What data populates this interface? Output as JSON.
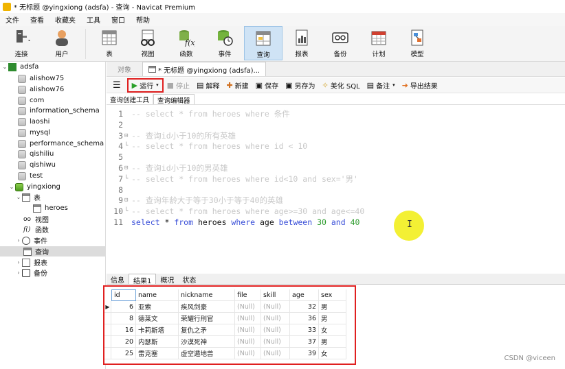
{
  "window": {
    "title": "* 无标题 @yingxiong (adsfa) - 查询 - Navicat Premium"
  },
  "menu": [
    "文件",
    "查看",
    "收藏夹",
    "工具",
    "窗口",
    "帮助"
  ],
  "ribbon": [
    {
      "label": "连接",
      "icon": "connection-icon"
    },
    {
      "label": "用户",
      "icon": "user-icon"
    },
    {
      "label": "表",
      "icon": "table-icon"
    },
    {
      "label": "视图",
      "icon": "view-icon"
    },
    {
      "label": "函数",
      "icon": "function-icon"
    },
    {
      "label": "事件",
      "icon": "event-icon"
    },
    {
      "label": "查询",
      "icon": "query-icon"
    },
    {
      "label": "报表",
      "icon": "report-icon"
    },
    {
      "label": "备份",
      "icon": "backup-icon"
    },
    {
      "label": "计划",
      "icon": "schedule-icon"
    },
    {
      "label": "模型",
      "icon": "model-icon"
    }
  ],
  "sidebar": {
    "connection": "adsfa",
    "databases": [
      "alishow75",
      "alishow76",
      "com",
      "information_schema",
      "laoshi",
      "mysql",
      "performance_schema",
      "qishiliu",
      "qishiwu",
      "test"
    ],
    "open_db": "yingxiong",
    "children": {
      "tables_label": "表",
      "table_item": "heroes",
      "views_label": "视图",
      "functions_label": "函数",
      "events_label": "事件",
      "queries_label": "查询",
      "reports_label": "报表",
      "backups_label": "备份"
    }
  },
  "tabs": {
    "objects": "对象",
    "query": "* 无标题 @yingxiong (adsfa)..."
  },
  "toolbar": {
    "run": "运行",
    "stop": "停止",
    "explain": "解释",
    "new": "新建",
    "save": "保存",
    "save_as": "另存为",
    "beautify": "美化 SQL",
    "comment": "备注",
    "export": "导出结果"
  },
  "subtabs": [
    "查询创建工具",
    "查询编辑器"
  ],
  "editor": {
    "lines": [
      {
        "n": "1",
        "fold": "",
        "parts": [
          {
            "t": "-- select * from heroes where 条件",
            "c": "cmt"
          }
        ]
      },
      {
        "n": "2",
        "fold": "",
        "parts": []
      },
      {
        "n": "3",
        "fold": "⊟",
        "parts": [
          {
            "t": "-- 查询id小于10的所有英雄",
            "c": "cmt"
          }
        ]
      },
      {
        "n": "4",
        "fold": "└",
        "parts": [
          {
            "t": "-- select * from heroes where id < 10",
            "c": "cmt"
          }
        ]
      },
      {
        "n": "5",
        "fold": "",
        "parts": []
      },
      {
        "n": "6",
        "fold": "⊟",
        "parts": [
          {
            "t": "-- 查询id小于10的男英雄",
            "c": "cmt"
          }
        ]
      },
      {
        "n": "7",
        "fold": "└",
        "parts": [
          {
            "t": "-- select * from heroes where id<10 and sex='男'",
            "c": "cmt"
          }
        ]
      },
      {
        "n": "8",
        "fold": "",
        "parts": []
      },
      {
        "n": "9",
        "fold": "⊟",
        "parts": [
          {
            "t": "-- 查询年龄大于等于30小于等于40的英雄",
            "c": "cmt"
          }
        ]
      },
      {
        "n": "10",
        "fold": "└",
        "parts": [
          {
            "t": "-- select * from heroes where age>=30 and age<=40",
            "c": "cmt"
          }
        ]
      },
      {
        "n": "11",
        "fold": "",
        "parts": [
          {
            "t": "select",
            "c": "kw"
          },
          {
            "t": " * ",
            "c": "plain"
          },
          {
            "t": "from",
            "c": "kw"
          },
          {
            "t": " heroes ",
            "c": "plain"
          },
          {
            "t": "where",
            "c": "kw"
          },
          {
            "t": " age ",
            "c": "plain"
          },
          {
            "t": "between",
            "c": "kw"
          },
          {
            "t": " ",
            "c": "plain"
          },
          {
            "t": "30",
            "c": "num"
          },
          {
            "t": " ",
            "c": "plain"
          },
          {
            "t": "and",
            "c": "kw"
          },
          {
            "t": " ",
            "c": "plain"
          },
          {
            "t": "40",
            "c": "num"
          }
        ]
      }
    ]
  },
  "result_tabs": [
    "信息",
    "结果1",
    "概况",
    "状态"
  ],
  "results": {
    "columns": [
      "id",
      "name",
      "nickname",
      "file",
      "skill",
      "age",
      "sex"
    ],
    "rows": [
      [
        "6",
        "亚索",
        "疾风剑豪",
        "(Null)",
        "(Null)",
        "32",
        "男"
      ],
      [
        "8",
        "德莱文",
        "荣耀行刑官",
        "(Null)",
        "(Null)",
        "36",
        "男"
      ],
      [
        "16",
        "卡莉斯塔",
        "复仇之矛",
        "(Null)",
        "(Null)",
        "33",
        "女"
      ],
      [
        "20",
        "内瑟斯",
        "沙漠死神",
        "(Null)",
        "(Null)",
        "37",
        "男"
      ],
      [
        "25",
        "雷克塞",
        "虚空遁地兽",
        "(Null)",
        "(Null)",
        "39",
        "女"
      ]
    ]
  },
  "watermark": "CSDN @viceen"
}
